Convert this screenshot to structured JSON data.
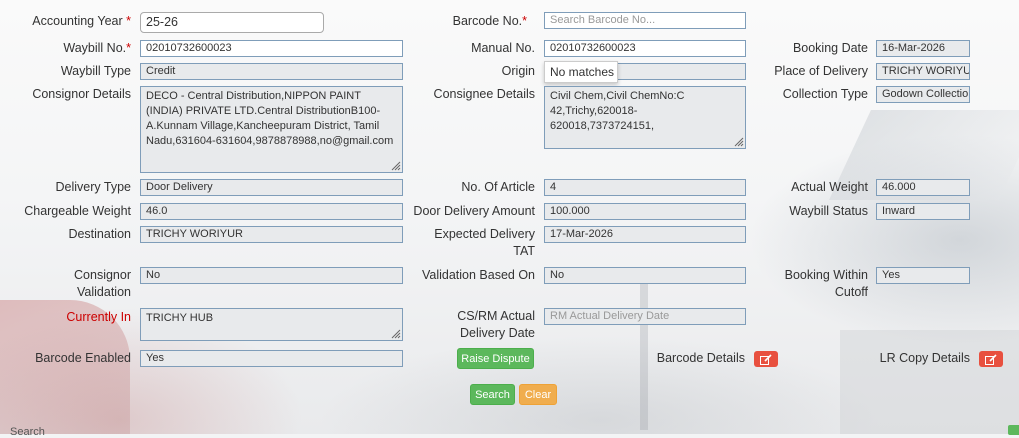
{
  "form": {
    "accounting_year": {
      "label": "Accounting Year",
      "value": "25-26"
    },
    "barcode_no": {
      "label": "Barcode No.",
      "placeholder": "Search Barcode No..."
    },
    "waybill_no": {
      "label": "Waybill No.",
      "value": "02010732600023"
    },
    "manual_no": {
      "label": "Manual No.",
      "value": "02010732600023"
    },
    "booking_date": {
      "label": "Booking Date",
      "value": "16-Mar-2026"
    },
    "waybill_type": {
      "label": "Waybill Type",
      "value": "Credit"
    },
    "origin": {
      "label": "Origin",
      "value": "",
      "dropdown_text": "No matches"
    },
    "place_of_delivery": {
      "label": "Place of Delivery",
      "value": "TRICHY WORIYUR"
    },
    "consignor_details": {
      "label": "Consignor Details",
      "value": "DECO - Central Distribution,NIPPON PAINT (INDIA) PRIVATE LTD.Central DistributionB100-A.Kunnam Village,Kancheepuram District, Tamil Nadu,631604-631604,9878878988,no@gmail.com"
    },
    "consignee_details": {
      "label": "Consignee Details",
      "value": "Civil Chem,Civil ChemNo:C 42,Trichy,620018-620018,7373724151,"
    },
    "collection_type": {
      "label": "Collection Type",
      "value": "Godown Collection"
    },
    "delivery_type": {
      "label": "Delivery Type",
      "value": "Door Delivery"
    },
    "no_of_article": {
      "label": "No. Of Article",
      "value": "4"
    },
    "actual_weight": {
      "label": "Actual Weight",
      "value": "46.000"
    },
    "chargeable_weight": {
      "label": "Chargeable Weight",
      "value": "46.0"
    },
    "door_delivery_amount": {
      "label": "Door Delivery Amount",
      "value": "100.000"
    },
    "waybill_status": {
      "label": "Waybill Status",
      "value": "Inward"
    },
    "destination": {
      "label": "Destination",
      "value": "TRICHY WORIYUR"
    },
    "expected_delivery_tat": {
      "label_line1": "Expected Delivery",
      "label_line2": "TAT",
      "value": "17-Mar-2026"
    },
    "consignor_validation": {
      "label_line1": "Consignor",
      "label_line2": "Validation",
      "value": "No"
    },
    "validation_based_on": {
      "label": "Validation Based On",
      "value": "No"
    },
    "booking_within_cutoff": {
      "label_line1": "Booking Within",
      "label_line2": "Cutoff",
      "value": "Yes"
    },
    "currently_in": {
      "label": "Currently In",
      "value": "TRICHY HUB"
    },
    "cs_rm_actual_delivery_date": {
      "label_line1": "CS/RM Actual",
      "label_line2": "Delivery Date",
      "placeholder": "RM Actual Delivery Date"
    },
    "barcode_enabled": {
      "label": "Barcode Enabled",
      "value": "Yes"
    },
    "barcode_details": {
      "label": "Barcode Details"
    },
    "lr_copy_details": {
      "label": "LR Copy Details"
    }
  },
  "buttons": {
    "raise_dispute": "Raise Dispute",
    "search": "Search",
    "clear": "Clear"
  },
  "footer": {
    "text": "Search"
  },
  "colors": {
    "required": "#cc0000",
    "green": "#5cb85c",
    "orange": "#f0ad4e",
    "edit": "#e8503f"
  },
  "icons": {
    "edit": "edit-icon",
    "resize": "resize-grip-icon"
  }
}
